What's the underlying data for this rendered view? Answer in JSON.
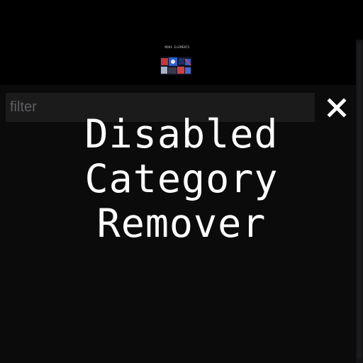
{
  "preview": {
    "caption": "MODS ELEMENTS",
    "thumbnail_icon": "mod-thumbnail-image"
  },
  "filter": {
    "placeholder": "filter",
    "value": ""
  },
  "close_button": {
    "icon": "close-icon"
  },
  "overlay_title": {
    "line1": "Disabled",
    "line2": "Category",
    "line3": "Remover"
  },
  "colors": {
    "background": "#000000",
    "panel": "#0b0b0c",
    "field": "#1b1b1c",
    "title_text": "#ffffff",
    "placeholder_text": "#5f5f62"
  }
}
